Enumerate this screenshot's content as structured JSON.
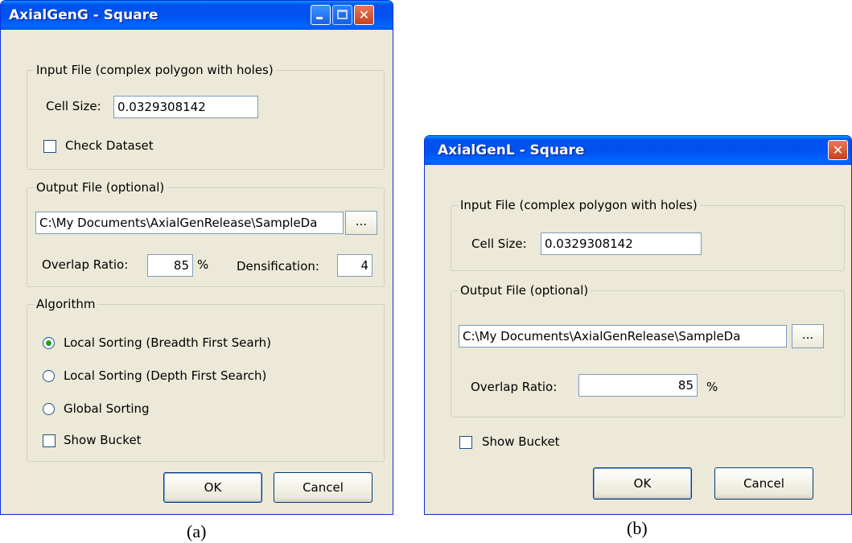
{
  "dialog_a": {
    "title": "AxialGenG - Square",
    "input_group": {
      "legend": "Input File (complex polygon with holes)",
      "cell_size_label": "Cell Size:",
      "cell_size_value": "0.0329308142",
      "check_dataset_label": "Check Dataset"
    },
    "output_group": {
      "legend": "Output File (optional)",
      "path_value": "C:\\My Documents\\AxialGenRelease\\SampleDa",
      "browse_label": "...",
      "overlap_label": "Overlap Ratio:",
      "overlap_value": "85",
      "overlap_unit": "%",
      "densification_label": "Densification:",
      "densification_value": "4"
    },
    "algorithm_group": {
      "legend": "Algorithm",
      "options": [
        {
          "label": "Local Sorting (Breadth First Searh)",
          "selected": true
        },
        {
          "label": "Local Sorting (Depth First Search)",
          "selected": false
        },
        {
          "label": "Global Sorting",
          "selected": false
        }
      ],
      "show_bucket_label": "Show Bucket"
    },
    "ok_label": "OK",
    "cancel_label": "Cancel",
    "caption": "(a)"
  },
  "dialog_b": {
    "title": "AxialGenL - Square",
    "input_group": {
      "legend": "Input File (complex polygon with holes)",
      "cell_size_label": "Cell Size:",
      "cell_size_value": "0.0329308142"
    },
    "output_group": {
      "legend": "Output File (optional)",
      "path_value": "C:\\My Documents\\AxialGenRelease\\SampleDa",
      "browse_label": "...",
      "overlap_label": "Overlap Ratio:",
      "overlap_value": "85",
      "overlap_unit": "%"
    },
    "show_bucket_label": "Show Bucket",
    "ok_label": "OK",
    "cancel_label": "Cancel",
    "caption": "(b)"
  }
}
